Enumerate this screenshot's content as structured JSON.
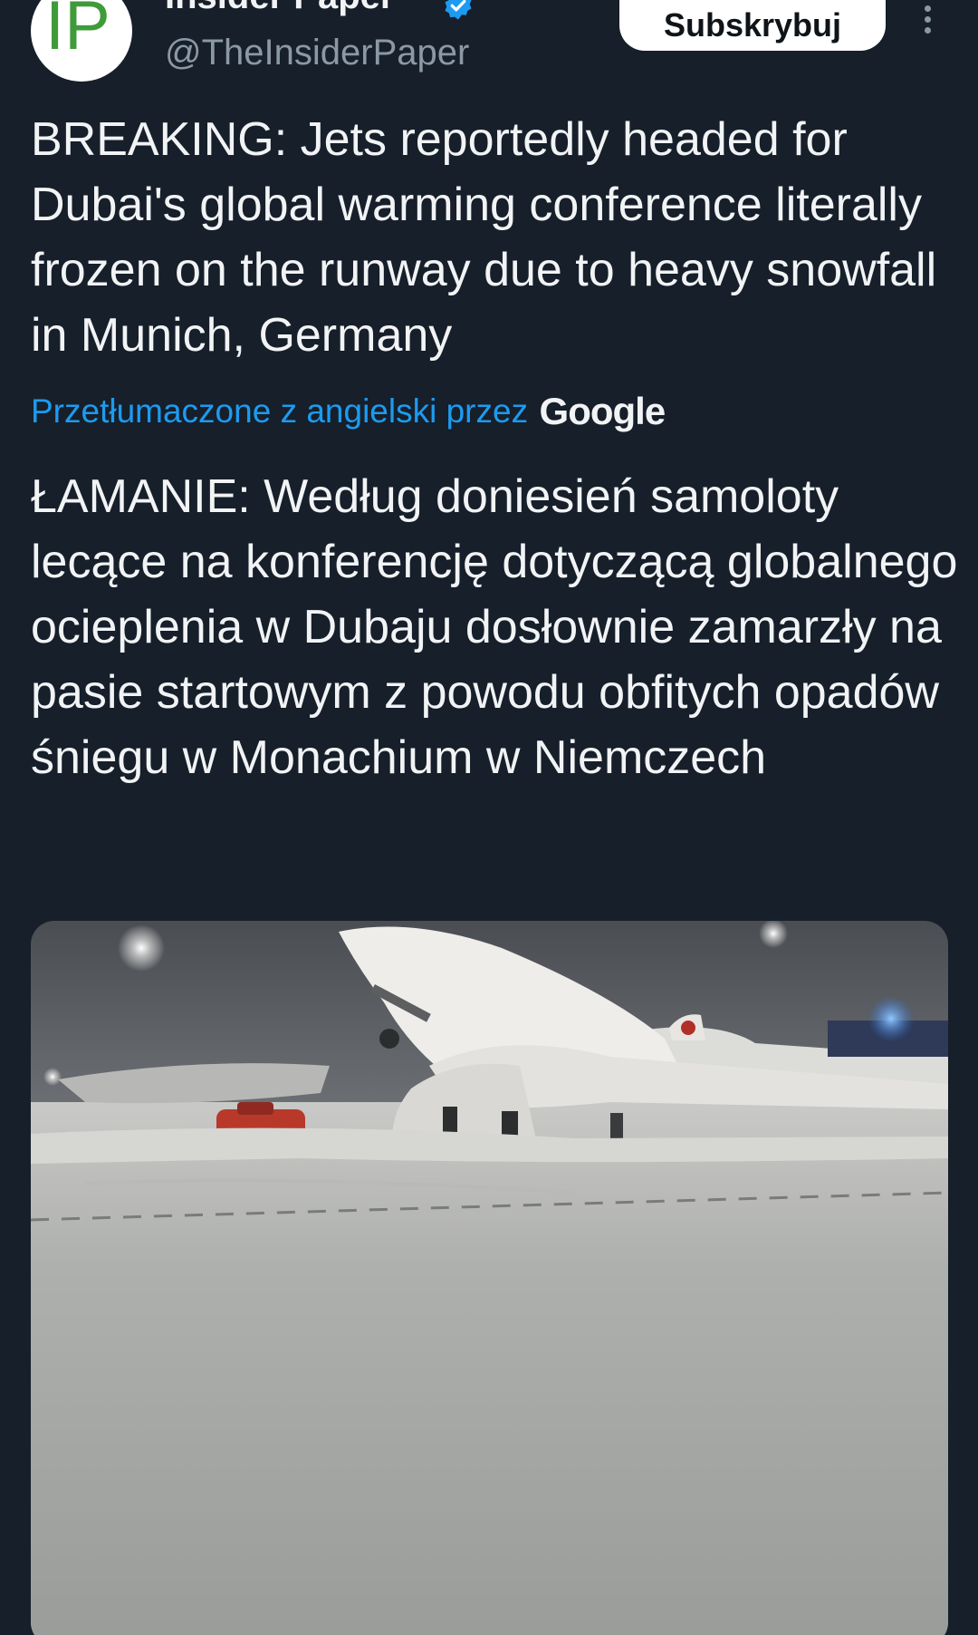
{
  "account": {
    "display_name": "Insider Paper",
    "handle": "@TheInsiderPaper",
    "avatar_text": "IP",
    "verified": true
  },
  "actions": {
    "subscribe_label": "Subskrybuj",
    "more_icon": "more-vertical-icon"
  },
  "tweet": {
    "text": "BREAKING: Jets reportedly headed for Dubai's global warming conference literally frozen on the runway due to heavy snowfall in Munich, Germany",
    "translation_label": "Przetłumaczone z angielski przez",
    "translation_provider": "Google",
    "translated_text": "ŁAMANIE: Według doniesień samoloty lecące na konferencję dotyczącą globalnego ocieplenia w Dubaju dosłownie zamarzły na pasie startowym z powodu obfitych opadów śniegu w Monachium w Niemczech"
  },
  "colors": {
    "background": "#161f2a",
    "text": "#f1f3f5",
    "secondary_text": "#8b98a5",
    "link": "#1d9bf0",
    "verified": "#1d9bf0",
    "avatar_logo": "#3f9b3a"
  }
}
